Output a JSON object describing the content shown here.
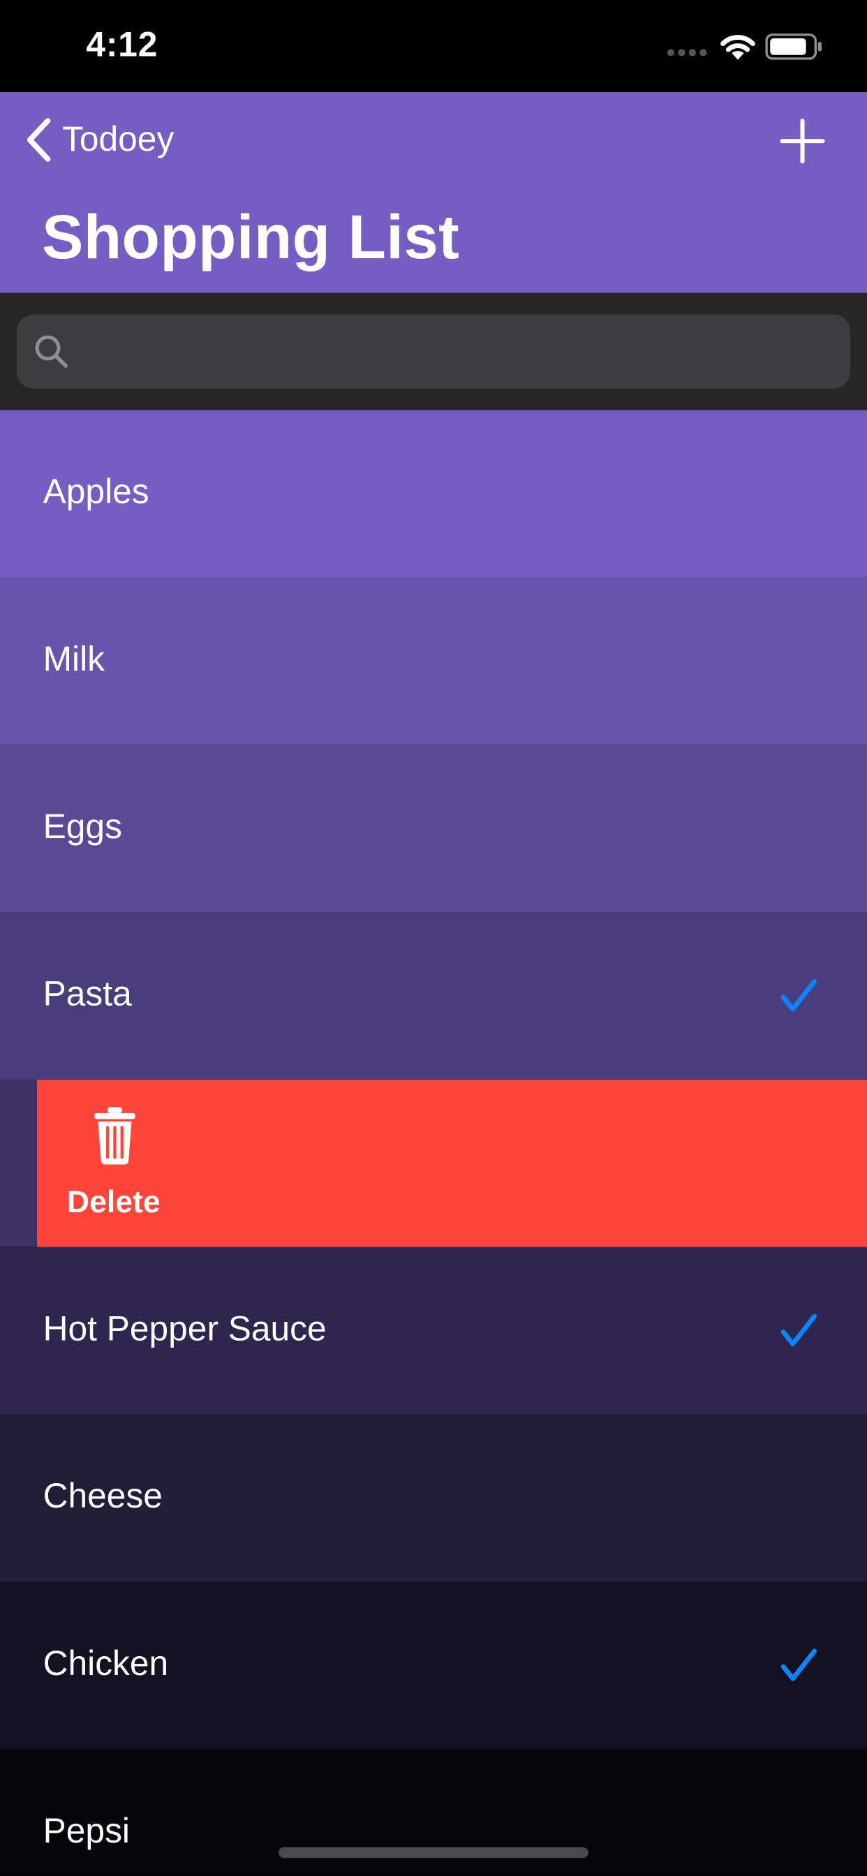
{
  "status_bar": {
    "time": "4:12"
  },
  "nav": {
    "back_label": "Todoey",
    "title": "Shopping List"
  },
  "search": {
    "placeholder": ""
  },
  "items": [
    {
      "label": "Apples",
      "checked": false,
      "color": "#745ec4"
    },
    {
      "label": "Milk",
      "checked": false,
      "color": "#6755ad"
    },
    {
      "label": "Eggs",
      "checked": false,
      "color": "#5a4a95"
    },
    {
      "label": "Pasta",
      "checked": true,
      "color": "#4a3d7c"
    },
    {
      "label": "",
      "checked": false,
      "color": "#3c3264",
      "swiped": true
    },
    {
      "label": "Hot Pepper Sauce",
      "checked": true,
      "color": "#2e264f"
    },
    {
      "label": "Cheese",
      "checked": false,
      "color": "#211c38"
    },
    {
      "label": "Chicken",
      "checked": true,
      "color": "#141122"
    },
    {
      "label": "Pepsi",
      "checked": false,
      "color": "#060509"
    }
  ],
  "swipe_action": {
    "label": "Delete",
    "icon": "trash-icon",
    "color": "#ff453a"
  },
  "colors": {
    "nav_bg": "#745ec4",
    "checkmark": "#0a84ff",
    "search_bg": "#262626",
    "search_field": "#3d3d3f"
  }
}
